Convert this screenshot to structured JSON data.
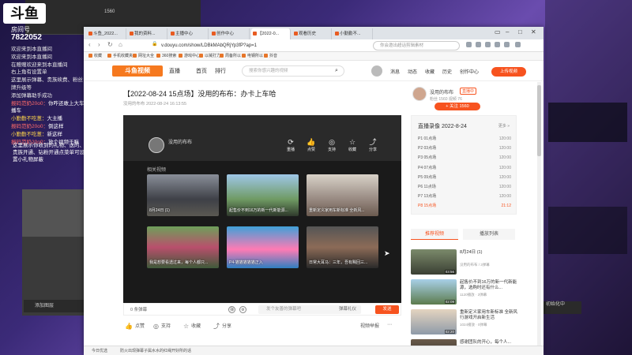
{
  "stream": {
    "logo": "斗鱼",
    "room_label": "房间号",
    "room_id": "7822052",
    "chat": [
      {
        "name": "",
        "text": "欢迎来到本直播间",
        "kind": "sys"
      },
      {
        "name": "",
        "text": "欢迎来到本直播间",
        "kind": "sys"
      },
      {
        "name": "",
        "text": "在赠赠欢迎来到本直播间",
        "kind": "sys"
      },
      {
        "name": "",
        "text": "右上角有设置单",
        "kind": "sys"
      },
      {
        "name": "",
        "text": "这里展示弹幕、贵族续费、粉丝牌升级等",
        "kind": "sys"
      },
      {
        "name": "",
        "text": "添加弹幕助手成功",
        "kind": "sys"
      },
      {
        "name": "报码范奶20o0：",
        "text": "你咋还敢上大车播车",
        "kind": "user"
      },
      {
        "name": "小勤勤不吃葱：",
        "text": "大主播",
        "kind": "user-y"
      },
      {
        "name": "报码范奶20o0：",
        "text": "倒这样",
        "kind": "user"
      },
      {
        "name": "小勤勤不吃葱：",
        "text": "新这样",
        "kind": "user-y"
      },
      {
        "name": "报码范奶20o0：",
        "text": "放个视频干嘛",
        "kind": "user"
      }
    ],
    "promo": "这里展示你收到的礼物、送的、贵族开通、钻粉开通点菜单可设置小礼物屏蔽",
    "back_window_count": "1560",
    "left_window_label": "添加图层",
    "right_small_label": "初始化中"
  },
  "browser": {
    "tabs": [
      {
        "label": "斗鱼_2022..."
      },
      {
        "label": "我的资料..."
      },
      {
        "label": "主播中心"
      },
      {
        "label": "创作中心"
      },
      {
        "label": "【2022-0..."
      },
      {
        "label": "观看历史"
      },
      {
        "label": "小勤勤不..."
      }
    ],
    "url": "v.douyu.com/show/LDBkMAbQRjYp3fP?ap=1",
    "search_placeholder": "你会邀出超话剪辑素材",
    "bookmarks": [
      "收藏",
      "手机收藏夹",
      "网址大全",
      "360搜索",
      "游戏中心",
      "以械打力",
      "周备所以",
      "电钢所以",
      "抖音"
    ]
  },
  "douyu": {
    "logo_text": "斗鱼视频",
    "nav": [
      "首页",
      "排行"
    ],
    "live_label": "直播",
    "search_placeholder": "搜索你感兴趣的视频",
    "header_links": [
      "消息",
      "动态",
      "收藏",
      "历史",
      "创作中心"
    ],
    "upload_label": "上传视频",
    "video_title": "【2022-08-24 15点场】没用的布布：办卡上车哈",
    "video_meta": "没用的布布   2022-08-24 16:13:55"
  },
  "player": {
    "author": "没用的布布",
    "actions": [
      {
        "icon": "⟳",
        "label": "重播"
      },
      {
        "icon": "👍",
        "label": "点赞"
      },
      {
        "icon": "◎",
        "label": "支持"
      },
      {
        "icon": "☆",
        "label": "收藏"
      },
      {
        "icon": "⤴",
        "label": "分享"
      }
    ],
    "related_label": "相关视频",
    "related": [
      {
        "caption": "8月24日 (1)"
      },
      {
        "caption": "起售价不到16万的新一代新能源..."
      },
      {
        "caption": "重新定义家用车新标准 全新风..."
      },
      {
        "caption": "我是想要看透过来，每个人都只..."
      },
      {
        "caption": "P4-猫猫猫猫猫正入"
      },
      {
        "caption": "日常大耳马：三年，吾有赐回三..."
      }
    ]
  },
  "underbar": {
    "danmu_count": "0 条弹幕",
    "danmu_placeholder": "发个友善的弹幕吧",
    "danmu_setting": "弹幕礼仪",
    "send_label": "发送",
    "actions": [
      "点赞",
      "支持",
      "收藏",
      "分享"
    ],
    "report_label": "视频举报",
    "status_left": "今日优选",
    "status_mid": "防火出现弹幕子属水水的红绳开好所的话"
  },
  "sidebar": {
    "author": "没用的布布",
    "live_badge": "直播中",
    "stats": "粉丝 1560  视频 76",
    "follow_label": "+ 关注  1560",
    "replay_title": "直播录像 2022-8-24",
    "replay_more": "更多 »",
    "parts": [
      {
        "label": "P1 01点场",
        "dur": "120:00",
        "current": false
      },
      {
        "label": "P2 03点场",
        "dur": "120:00",
        "current": false
      },
      {
        "label": "P3 05点场",
        "dur": "120:00",
        "current": false
      },
      {
        "label": "P4 07点场",
        "dur": "120:00",
        "current": false
      },
      {
        "label": "P5 09点场",
        "dur": "120:00",
        "current": false
      },
      {
        "label": "P6 11点场",
        "dur": "120:00",
        "current": false
      },
      {
        "label": "P7 13点场",
        "dur": "120:00",
        "current": false
      },
      {
        "label": "P8 15点场",
        "dur": "21:12",
        "current": true
      }
    ],
    "tab_recommend": "推荐视频",
    "tab_list": "播放列表",
    "recommends": [
      {
        "title": "8月24日 (1)",
        "meta": "没用的布布 / 3弹幕",
        "dur": "03:56"
      },
      {
        "title": "起售价不到16万的新一代新能源，选购时还有什么...",
        "meta": "1120播放 · 3弹幕",
        "dur": "02:09"
      },
      {
        "title": "重新定义家用车新标准 全新风行游戏开启新生活",
        "meta": "1024播放 · 0弹幕",
        "dur": "02:20"
      },
      {
        "title": "感谢团队的开心，每个人...",
        "meta": "",
        "dur": ""
      }
    ]
  }
}
